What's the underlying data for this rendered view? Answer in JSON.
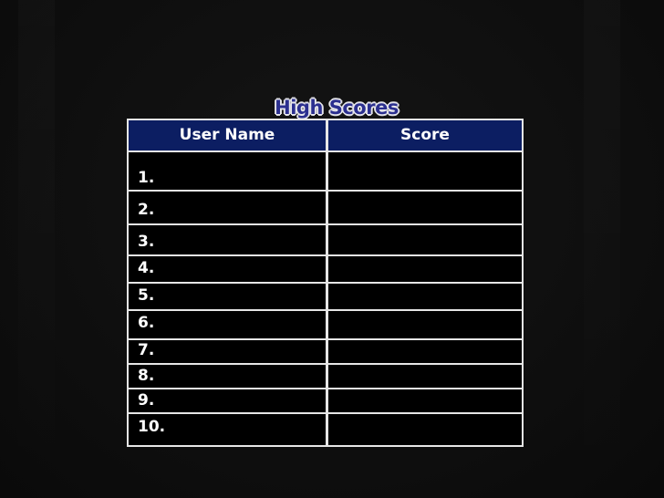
{
  "title": "High Scores",
  "columns": {
    "user": "User Name",
    "score": "Score"
  },
  "rows": [
    {
      "rank": "1.",
      "user": "",
      "score": ""
    },
    {
      "rank": "2.",
      "user": "",
      "score": ""
    },
    {
      "rank": "3.",
      "user": "",
      "score": ""
    },
    {
      "rank": "4.",
      "user": "",
      "score": ""
    },
    {
      "rank": "5.",
      "user": "",
      "score": ""
    },
    {
      "rank": "6.",
      "user": "",
      "score": ""
    },
    {
      "rank": "7.",
      "user": "",
      "score": ""
    },
    {
      "rank": "8.",
      "user": "",
      "score": ""
    },
    {
      "rank": "9.",
      "user": "",
      "score": ""
    },
    {
      "rank": "10.",
      "user": "",
      "score": ""
    }
  ],
  "colors": {
    "background": "#0d0d0d",
    "header": "#0c1e62",
    "title": "#2b2f8f",
    "grid": "#e6e6e6"
  }
}
